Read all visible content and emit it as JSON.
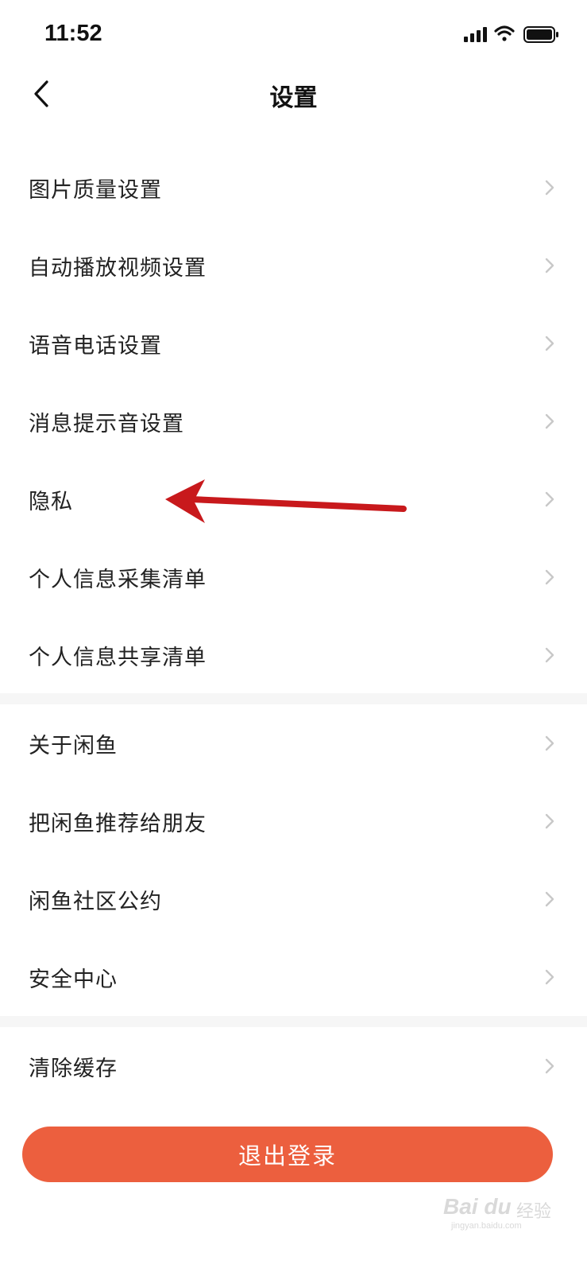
{
  "status": {
    "time": "11:52",
    "signal_icon": "signal-icon",
    "wifi_icon": "wifi-icon",
    "battery_icon": "battery-icon"
  },
  "nav": {
    "back_icon": "chevron-left-icon",
    "title": "设置"
  },
  "groups": [
    {
      "items": [
        {
          "label": "图片质量设置"
        },
        {
          "label": "自动播放视频设置"
        },
        {
          "label": "语音电话设置"
        },
        {
          "label": "消息提示音设置"
        },
        {
          "label": "隐私"
        },
        {
          "label": "个人信息采集清单"
        },
        {
          "label": "个人信息共享清单"
        }
      ]
    },
    {
      "items": [
        {
          "label": "关于闲鱼"
        },
        {
          "label": "把闲鱼推荐给朋友"
        },
        {
          "label": "闲鱼社区公约"
        },
        {
          "label": "安全中心"
        }
      ]
    },
    {
      "items": [
        {
          "label": "清除缓存"
        }
      ]
    }
  ],
  "logout_button": "退出登录",
  "annotation": {
    "type": "red-arrow",
    "points_to": "隐私",
    "color": "#c8191c"
  },
  "watermark": {
    "brand": "Bai du",
    "cn": "经验",
    "url": "jingyan.baidu.com"
  },
  "colors": {
    "accent": "#ec5f3e",
    "chevron": "#c8c8c8",
    "separator": "#f6f6f6"
  }
}
